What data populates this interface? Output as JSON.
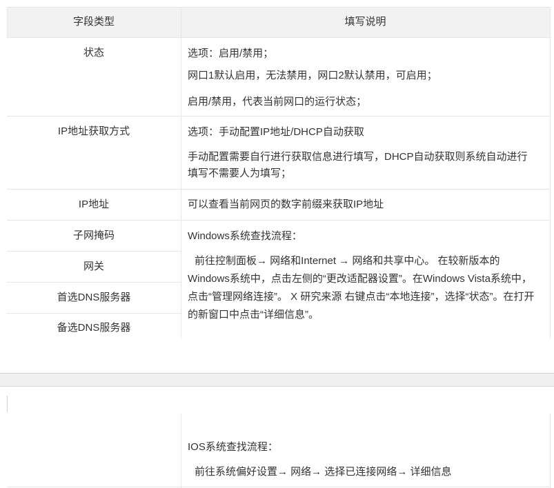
{
  "table": {
    "headers": {
      "type": "字段类型",
      "desc": "填写说明"
    },
    "rows": {
      "status": {
        "label": "状态",
        "lines": [
          "选项：启用/禁用；",
          "网口1默认启用，无法禁用，网口2默认禁用，可启用；",
          "启用/禁用，代表当前网口的运行状态；"
        ]
      },
      "ip_method": {
        "label": "IP地址获取方式",
        "lines": [
          "选项：手动配置IP地址/DHCP自动获取",
          "手动配置需要自行进行获取信息进行填写，DHCP自动获取则系统自动进行",
          "填写不需要人为填写；"
        ]
      },
      "ip": {
        "label": "IP地址",
        "lines": [
          "可以查看当前网页的数字前缀来获取IP地址"
        ]
      },
      "subnet": {
        "label": "子网掩码"
      },
      "gateway": {
        "label": "网关"
      },
      "dns1": {
        "label": "首选DNS服务器"
      },
      "dns2": {
        "label": "备选DNS服务器"
      }
    },
    "windows_block": {
      "title": "Windows系统查找流程：",
      "body": "前往控制面板→ 网络和Internet → 网络和共享中心。 在较新版本的Windows系统中，点击左侧的“更改适配器设置”。在Windows Vista系统中，点击“管理网络连接”。 X 研究来源 右键点击“本地连接”，选择“状态”。在打开的新窗口中点击“详细信息”。"
    },
    "ios_block": {
      "title": "IOS系统查找流程：",
      "body": "前往系统偏好设置→ 网络→ 选择已连接网络→ 详细信息"
    }
  }
}
